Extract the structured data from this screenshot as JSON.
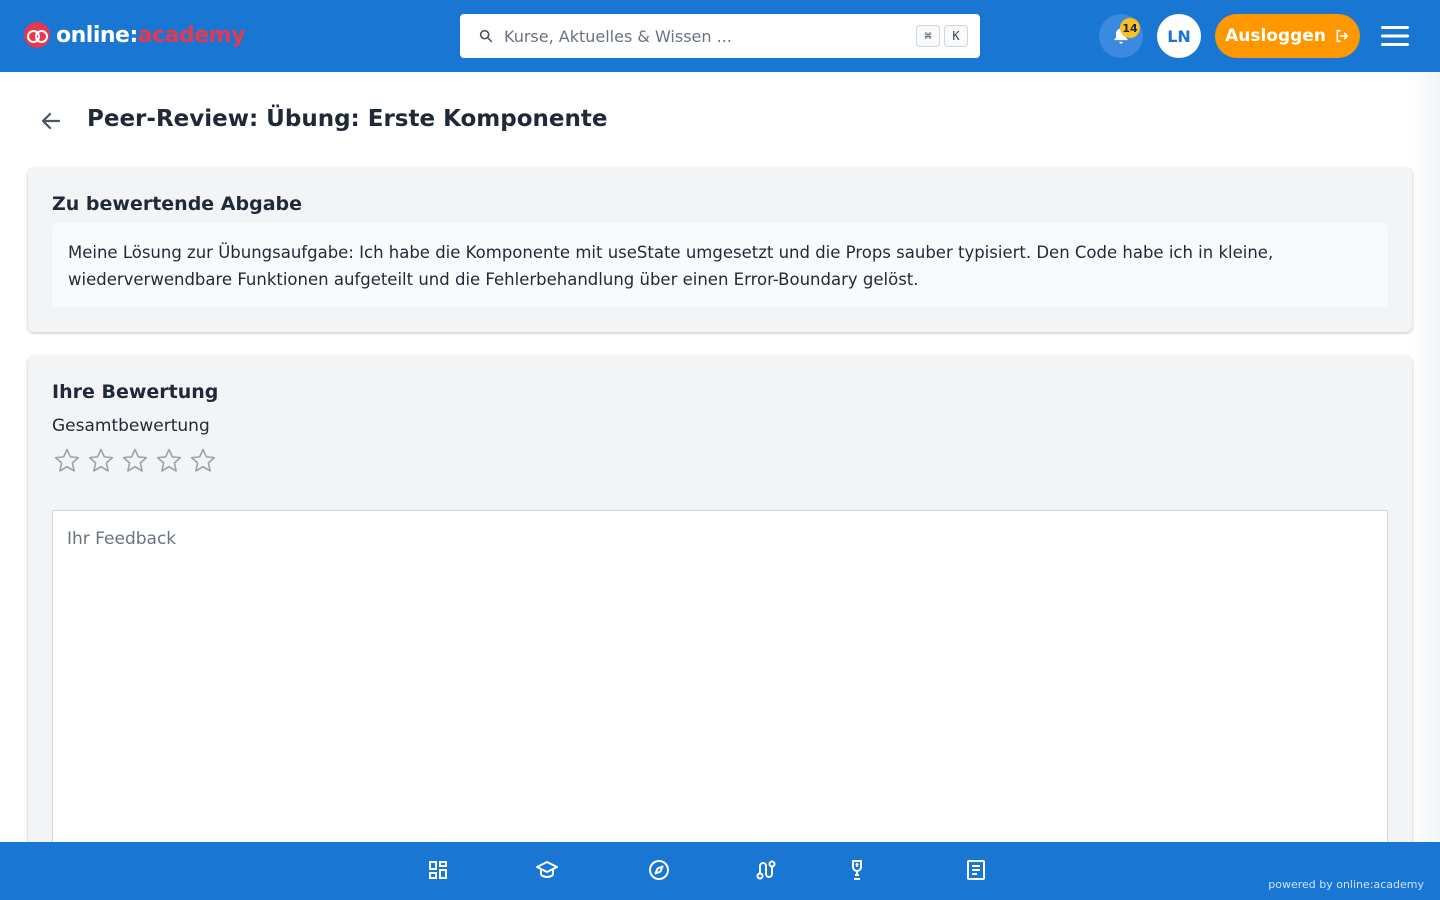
{
  "app": {
    "logo_text_main": "online:",
    "logo_text_accent": "academy"
  },
  "search": {
    "placeholder": "Kurse, Aktuelles & Wissen ...",
    "shortcut_modifier": "⌘",
    "shortcut_key": "K"
  },
  "header": {
    "notifications_count": "14",
    "avatar_initials": "LN",
    "logout_label": "Ausloggen"
  },
  "page": {
    "title": "Peer-Review: Übung: Erste Komponente"
  },
  "submission": {
    "title": "Zu bewertende Abgabe",
    "text": "Meine Lösung zur Übungsaufgabe: Ich habe die Komponente mit useState umgesetzt und die Props sauber typisiert. Den Code habe ich in kleine, wiederverwendbare Funktionen aufgeteilt und die Fehlerbehandlung über einen Error-Boundary gelöst."
  },
  "review": {
    "title": "Ihre Bewertung",
    "rating_label": "Gesamtbewertung",
    "rating_value": 0,
    "rating_max": 5,
    "feedback_placeholder": "Ihr Feedback",
    "feedback_value": ""
  },
  "bottom_nav": {
    "items": [
      {
        "icon": "dashboard-icon"
      },
      {
        "icon": "graduation-cap-icon"
      },
      {
        "icon": "compass-icon"
      },
      {
        "icon": "route-icon"
      },
      {
        "icon": "trophy-icon"
      },
      {
        "icon": "article-icon"
      }
    ],
    "powered_by": "powered by online:academy"
  },
  "colors": {
    "primary": "#1976d2",
    "accent_orange": "#ff9800",
    "brand_red": "#e53950",
    "badge_yellow": "#fbbf24"
  }
}
